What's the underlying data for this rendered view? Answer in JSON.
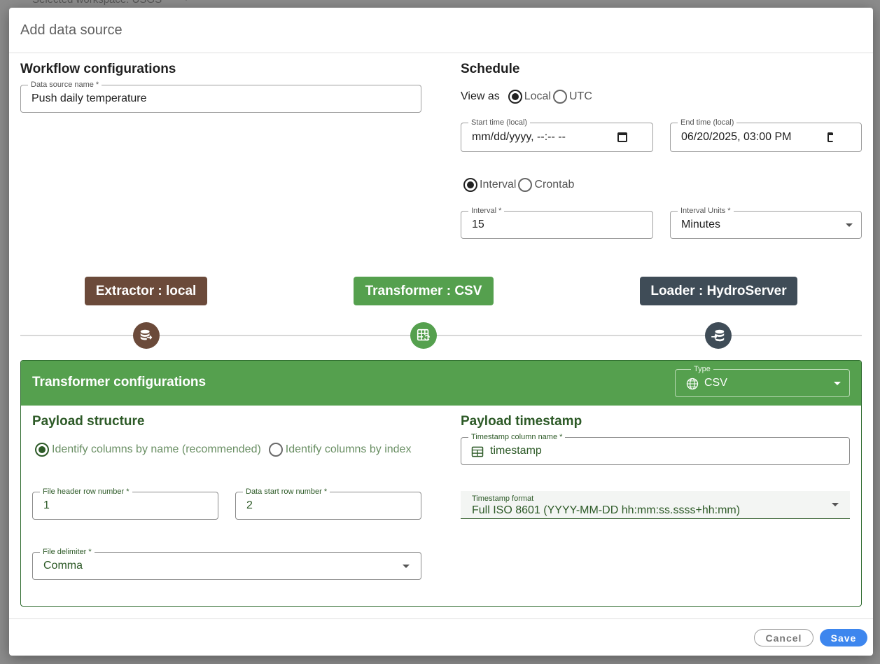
{
  "backdrop": {
    "workspace_text": "Selected workspace: USGS"
  },
  "dialog": {
    "title": "Add data source"
  },
  "workflow": {
    "title": "Workflow configurations",
    "name_label": "Data source name *",
    "name_value": "Push daily temperature"
  },
  "schedule": {
    "title": "Schedule",
    "view_as_label": "View as",
    "tz_options": [
      "Local",
      "UTC"
    ],
    "tz_selected": "Local",
    "start_label": "Start time (local)",
    "start_value": "mm/dd/yyyy, --:-- --",
    "end_label": "End time (local)",
    "end_value": "06/20/2025, 03:00 PM",
    "mode_options": [
      "Interval",
      "Crontab"
    ],
    "mode_selected": "Interval",
    "interval_label": "Interval *",
    "interval_value": "15",
    "units_label": "Interval Units *",
    "units_value": "Minutes"
  },
  "pipeline": {
    "extractor": {
      "label": "Extractor : local",
      "color": "#6b4a3a",
      "icon": "database-export-icon"
    },
    "transformer": {
      "label": "Transformer : CSV",
      "color": "#55a04e",
      "icon": "table-refresh-icon"
    },
    "loader": {
      "label": "Loader : HydroServer",
      "color": "#3f4c57",
      "icon": "database-import-icon"
    }
  },
  "transformer": {
    "title": "Transformer configurations",
    "type_label": "Type",
    "type_value": "CSV",
    "payload_structure_title": "Payload structure",
    "identify_options": [
      "Identify columns by name (recommended)",
      "Identify columns by index"
    ],
    "identify_selected": "Identify columns by name (recommended)",
    "header_row_label": "File header row number *",
    "header_row_value": "1",
    "data_start_label": "Data start row number *",
    "data_start_value": "2",
    "delimiter_label": "File delimiter *",
    "delimiter_value": "Comma",
    "payload_timestamp_title": "Payload timestamp",
    "ts_column_label": "Timestamp column name *",
    "ts_column_value": "timestamp",
    "ts_format_label": "Timestamp format",
    "ts_format_value": "Full ISO 8601 (YYYY-MM-DD hh:mm:ss.ssss+hh:mm)"
  },
  "actions": {
    "cancel": "Cancel",
    "save": "Save"
  }
}
